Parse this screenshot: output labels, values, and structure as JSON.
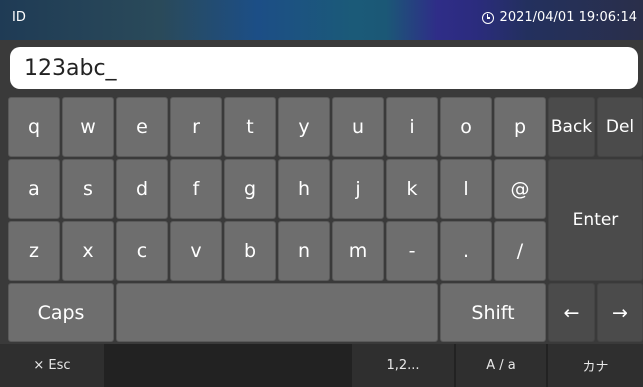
{
  "header": {
    "title": "ID",
    "datetime": "2021/04/01 19:06:14"
  },
  "input": {
    "value": "123abc_"
  },
  "rows": [
    [
      "q",
      "w",
      "e",
      "r",
      "t",
      "y",
      "u",
      "i",
      "o",
      "p"
    ],
    [
      "a",
      "s",
      "d",
      "f",
      "g",
      "h",
      "j",
      "k",
      "l",
      "@"
    ],
    [
      "z",
      "x",
      "c",
      "v",
      "b",
      "n",
      "m",
      "-",
      ".",
      "/"
    ]
  ],
  "keys": {
    "back": "Back",
    "del": "Del",
    "enter": "Enter",
    "caps": "Caps",
    "shift": "Shift",
    "left": "←",
    "right": "→"
  },
  "bottom": {
    "esc": "× Esc",
    "num": "1,2...",
    "case": "A / a",
    "kana": "カナ"
  }
}
